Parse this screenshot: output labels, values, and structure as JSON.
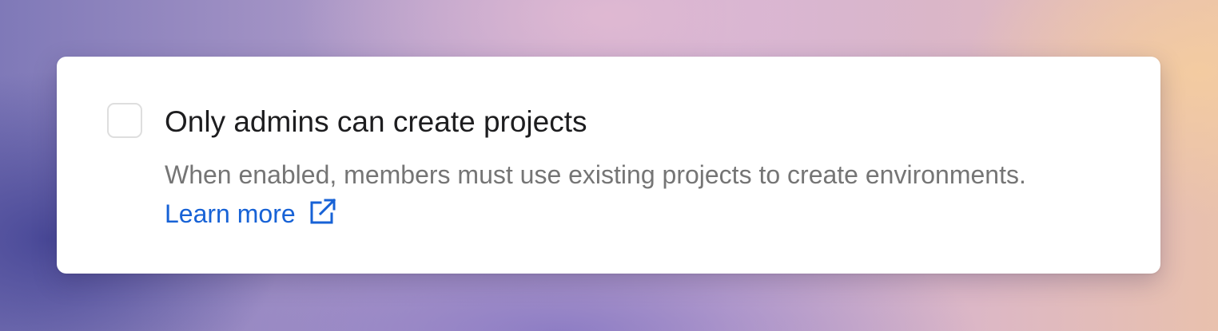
{
  "setting": {
    "checked": false,
    "title": "Only admins can create projects",
    "description": "When enabled, members must use existing projects to create environments.",
    "link_label": "Learn more",
    "link_icon": "external-link-icon"
  },
  "colors": {
    "title": "#1d1d1f",
    "description": "#757575",
    "link": "#1762d6",
    "checkbox_border": "#dedede"
  }
}
